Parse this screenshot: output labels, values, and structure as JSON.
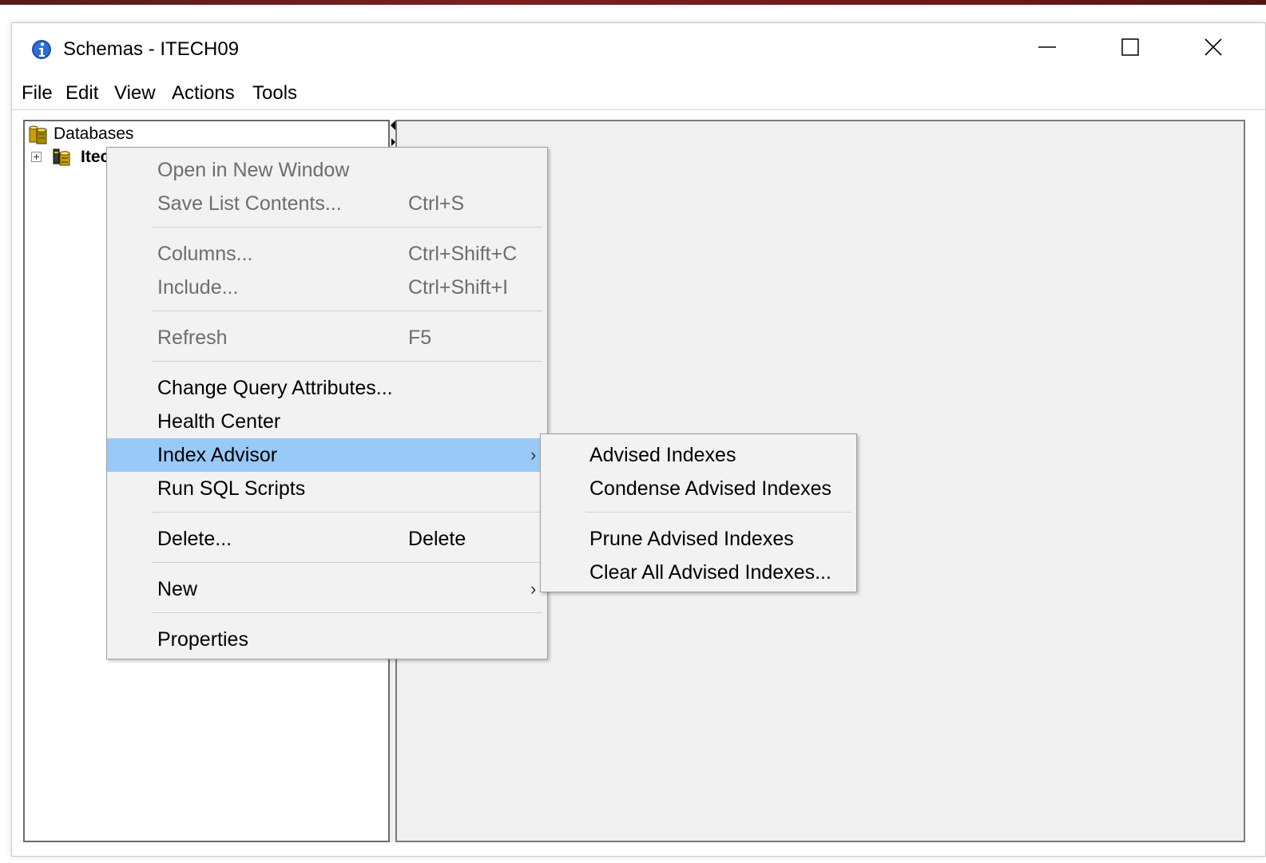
{
  "window": {
    "title": "Schemas - ITECH09"
  },
  "menubar": {
    "items": [
      "File",
      "Edit",
      "View",
      "Actions",
      "Tools"
    ]
  },
  "tree": {
    "root_label": "Databases",
    "child_label": "Itec"
  },
  "context_menu": {
    "items": [
      {
        "label": "Open in New Window",
        "shortcut": "",
        "enabled": false
      },
      {
        "label": "Save List Contents...",
        "shortcut": "Ctrl+S",
        "enabled": false
      },
      {
        "label": "Columns...",
        "shortcut": "Ctrl+Shift+C",
        "enabled": false
      },
      {
        "label": "Include...",
        "shortcut": "Ctrl+Shift+I",
        "enabled": false
      },
      {
        "label": "Refresh",
        "shortcut": "F5",
        "enabled": false
      },
      {
        "label": "Change Query Attributes...",
        "shortcut": "",
        "enabled": true
      },
      {
        "label": "Health Center",
        "shortcut": "",
        "enabled": true
      },
      {
        "label": "Index Advisor",
        "shortcut": "",
        "enabled": true,
        "highlighted": true,
        "submenu": true
      },
      {
        "label": "Run SQL Scripts",
        "shortcut": "",
        "enabled": true
      },
      {
        "label": "Delete...",
        "shortcut": "Delete",
        "enabled": true
      },
      {
        "label": "New",
        "shortcut": "",
        "enabled": true,
        "submenu": true
      },
      {
        "label": "Properties",
        "shortcut": "",
        "enabled": true
      }
    ]
  },
  "submenu": {
    "items": [
      {
        "label": "Advised Indexes"
      },
      {
        "label": "Condense Advised Indexes"
      },
      {
        "label": "Prune Advised Indexes"
      },
      {
        "label": "Clear All Advised Indexes..."
      }
    ]
  },
  "colors": {
    "highlight": "#99c9f6",
    "menu_background": "#f2f2f2",
    "disabled_text": "#6d6d6d"
  }
}
